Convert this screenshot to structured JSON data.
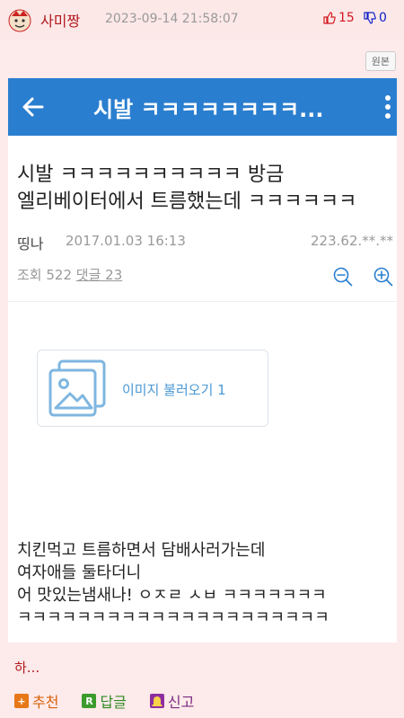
{
  "header": {
    "author": "사미짱",
    "timestamp": "2023-09-14 21:58:07",
    "upvotes": "15",
    "downvotes": "0",
    "original_label": "원본"
  },
  "screenshot": {
    "app_bar_title": "시발 ㅋㅋㅋㅋㅋㅋㅋㅋ...",
    "post_title_line1": "시발 ㅋㅋㅋㅋㅋㅋㅋㅋㅋㅋ 방금",
    "post_title_line2": "엘리베이터에서 트름했는데 ㅋㅋㅋㅋㅋㅋ",
    "author": "띵나",
    "date": "2017.01.03 16:13",
    "ip": "223.62.**.**",
    "views_label": "조회 522",
    "comments_label": "댓글 23",
    "image_label": "이미지 불러오기 1",
    "body_line1": "치킨먹고 트름하면서 담배사러가는데",
    "body_line2": "여자애들 둘타더니",
    "body_line3": "어 맛있는냄새나! ㅇㅈㄹ ㅅㅂ ㅋㅋㅋㅋㅋㅋㅋ",
    "body_line4": "ㅋㅋㅋㅋㅋㅋㅋㅋㅋㅋㅋㅋㅋㅋㅋㅋㅋㅋㅋㅋㅋ"
  },
  "comment": {
    "text": "하..."
  },
  "actions": {
    "recommend_label": "추천",
    "reply_label": "답글",
    "report_label": "신고"
  },
  "colors": {
    "accent": "#b0191e",
    "app_bar": "#2a7ecf",
    "background": "#fdeaea"
  }
}
